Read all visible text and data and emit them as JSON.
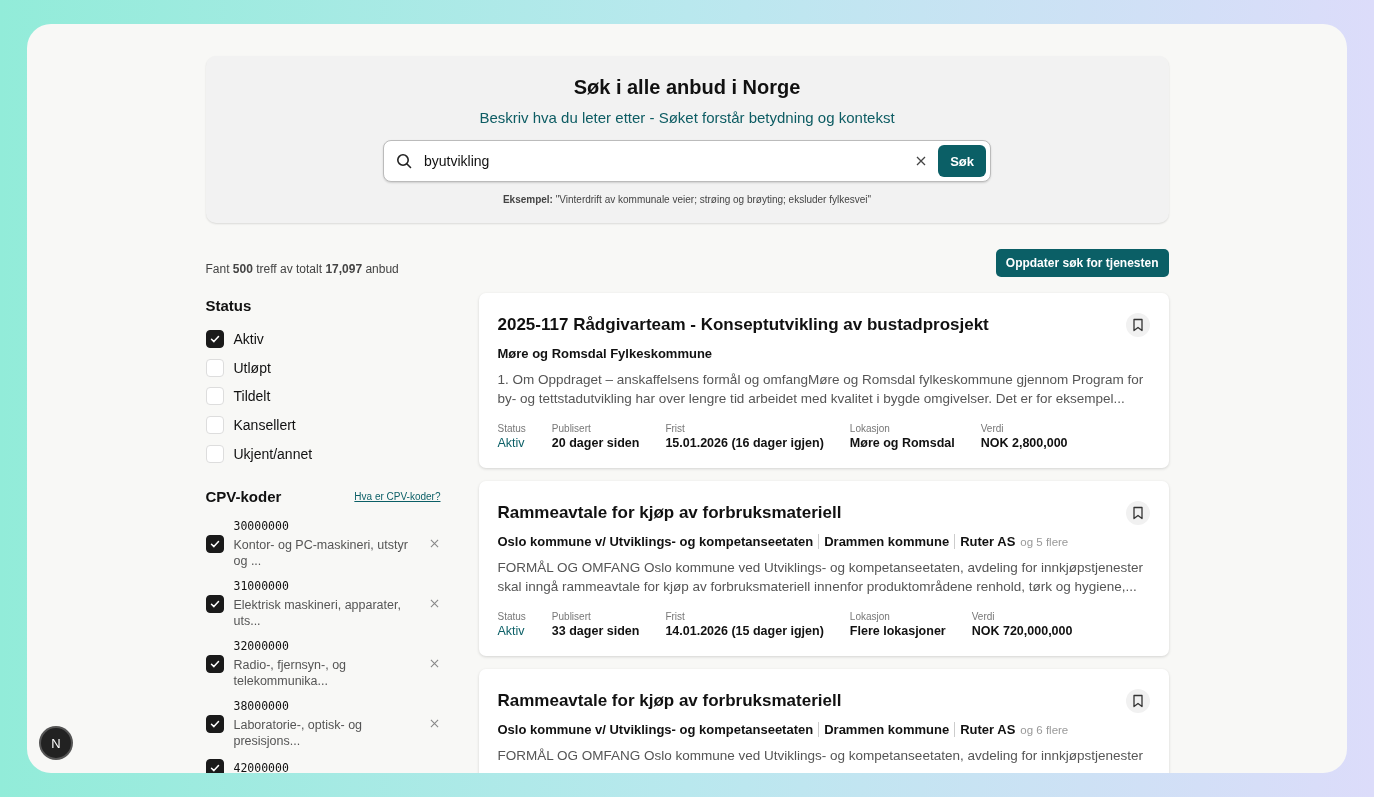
{
  "header": {
    "title": "Søk i alle anbud i Norge",
    "subtitle": "Beskriv hva du leter etter - Søket forstår betydning og kontekst",
    "search": {
      "value": "byutvikling",
      "button": "Søk"
    },
    "example": "**Eksempel:** \"Vinterdrift av kommunale veier; strøing og brøyting; eksluder fylkesvei\""
  },
  "results_summary": "Fant **500** treff av totalt **17,097** anbud",
  "update_button": "Oppdater søk for tjenesten",
  "status_filter": {
    "title": "Status",
    "options": [
      {
        "label": "Aktiv",
        "checked": true
      },
      {
        "label": "Utløpt",
        "checked": false
      },
      {
        "label": "Tildelt",
        "checked": false
      },
      {
        "label": "Kansellert",
        "checked": false
      },
      {
        "label": "Ukjent/annet",
        "checked": false
      }
    ]
  },
  "cpv_filter": {
    "title": "CPV-koder",
    "help_link": "Hva er CPV-koder?",
    "codes": [
      {
        "code": "30000000",
        "name": "Kontor- og PC-maskineri, utstyr og ...",
        "checked": true
      },
      {
        "code": "31000000",
        "name": "Elektrisk maskineri, apparater, uts...",
        "checked": true
      },
      {
        "code": "32000000",
        "name": "Radio-, fjernsyn-, og telekommunika...",
        "checked": true
      },
      {
        "code": "38000000",
        "name": "Laboratorie-, optisk- og presisjons...",
        "checked": true
      },
      {
        "code": "42000000",
        "checked": true
      }
    ]
  },
  "tenders": [
    {
      "title": "2025-117 Rådgivarteam - Konseptutvikling av bustadprosjekt",
      "buyers": [
        "Møre og Romsdal Fylkeskommune"
      ],
      "description": "1. Om Oppdraget – anskaffelsens formål og omfangMøre og Romsdal fylkeskommune gjennom Program for by- og tettstadutvikling har over lengre tid arbeidet med kvalitet i bygde omgivelser. Det er for eksempel...",
      "meta": [
        {
          "kind": "status",
          "label": "Status",
          "value": "Aktiv"
        },
        {
          "kind": "plain",
          "label": "Publisert",
          "value": "20 dager siden"
        },
        {
          "kind": "plain",
          "label": "Frist",
          "value": "15.01.2026 (16 dager igjen)"
        },
        {
          "kind": "plain",
          "label": "Lokasjon",
          "value": "Møre og Romsdal"
        },
        {
          "kind": "plain",
          "label": "Verdi",
          "value": "NOK 2,800,000"
        }
      ]
    },
    {
      "title": "Rammeavtale for kjøp av forbruksmateriell",
      "buyers": [
        "Oslo kommune v/ Utviklings- og kompetanseetaten",
        "Drammen kommune",
        "Ruter AS"
      ],
      "more_buyers": "og 5 flere",
      "description": "FORMÅL OG OMFANG Oslo kommune ved Utviklings- og kompetanseetaten, avdeling for innkjøpstjenester skal inngå rammeavtale for kjøp av forbruksmateriell innenfor produktområdene renhold, tørk og hygiene,...",
      "meta": [
        {
          "kind": "status",
          "label": "Status",
          "value": "Aktiv"
        },
        {
          "kind": "plain",
          "label": "Publisert",
          "value": "33 dager siden"
        },
        {
          "kind": "plain",
          "label": "Frist",
          "value": "14.01.2026 (15 dager igjen)"
        },
        {
          "kind": "plain",
          "label": "Lokasjon",
          "value": "Flere lokasjoner"
        },
        {
          "kind": "plain",
          "label": "Verdi",
          "value": "NOK 720,000,000"
        }
      ]
    },
    {
      "title": "Rammeavtale for kjøp av forbruksmateriell",
      "buyers": [
        "Oslo kommune v/ Utviklings- og kompetanseetaten",
        "Drammen kommune",
        "Ruter AS"
      ],
      "more_buyers": "og 6 flere",
      "description": "FORMÅL OG OMFANG Oslo kommune ved Utviklings- og kompetanseetaten, avdeling for innkjøpstjenester"
    }
  ],
  "dev_badge": "N"
}
